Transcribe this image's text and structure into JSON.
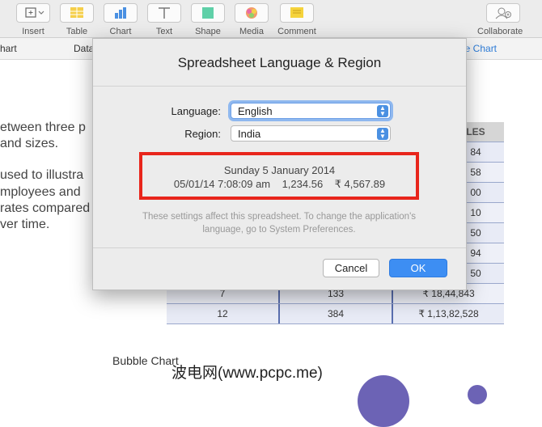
{
  "toolbar": {
    "items": [
      {
        "label": "Insert"
      },
      {
        "label": "Table"
      },
      {
        "label": "Chart"
      },
      {
        "label": "Text"
      },
      {
        "label": "Shape"
      },
      {
        "label": "Media"
      },
      {
        "label": "Comment"
      },
      {
        "label": "Collaborate"
      }
    ]
  },
  "tabs": {
    "left": "hart",
    "data": "Data",
    "right": "le Chart"
  },
  "doc": {
    "lines": [
      "etween three p",
      "and sizes.",
      "used to illustra",
      "mployees and",
      "rates compared",
      "ver time."
    ]
  },
  "table": {
    "header_right": "LES",
    "right_partial": [
      "84",
      "58",
      "00",
      "10",
      "50",
      "94",
      "50"
    ],
    "rows": [
      [
        "7",
        "133",
        "₹ 18,44,843"
      ],
      [
        "12",
        "384",
        "₹ 1,13,82,528"
      ]
    ]
  },
  "dialog": {
    "title": "Spreadsheet Language & Region",
    "language_label": "Language:",
    "language_value": "English",
    "region_label": "Region:",
    "region_value": "India",
    "preview_date": "Sunday 5 January 2014",
    "preview_formats": "05/01/14 7:08:09 am    1,234.56    ₹ 4,567.89",
    "note_line1": "These settings affect this spreadsheet. To change the application's",
    "note_line2": "language, go to System Preferences.",
    "cancel": "Cancel",
    "ok": "OK"
  },
  "bubble_chart_title": "Bubble Chart",
  "watermark": "波电网(www.pcpc.me)",
  "colors": {
    "accent": "#3d8ef3",
    "highlight": "#e8251b",
    "bubble": "#6c63b5"
  }
}
